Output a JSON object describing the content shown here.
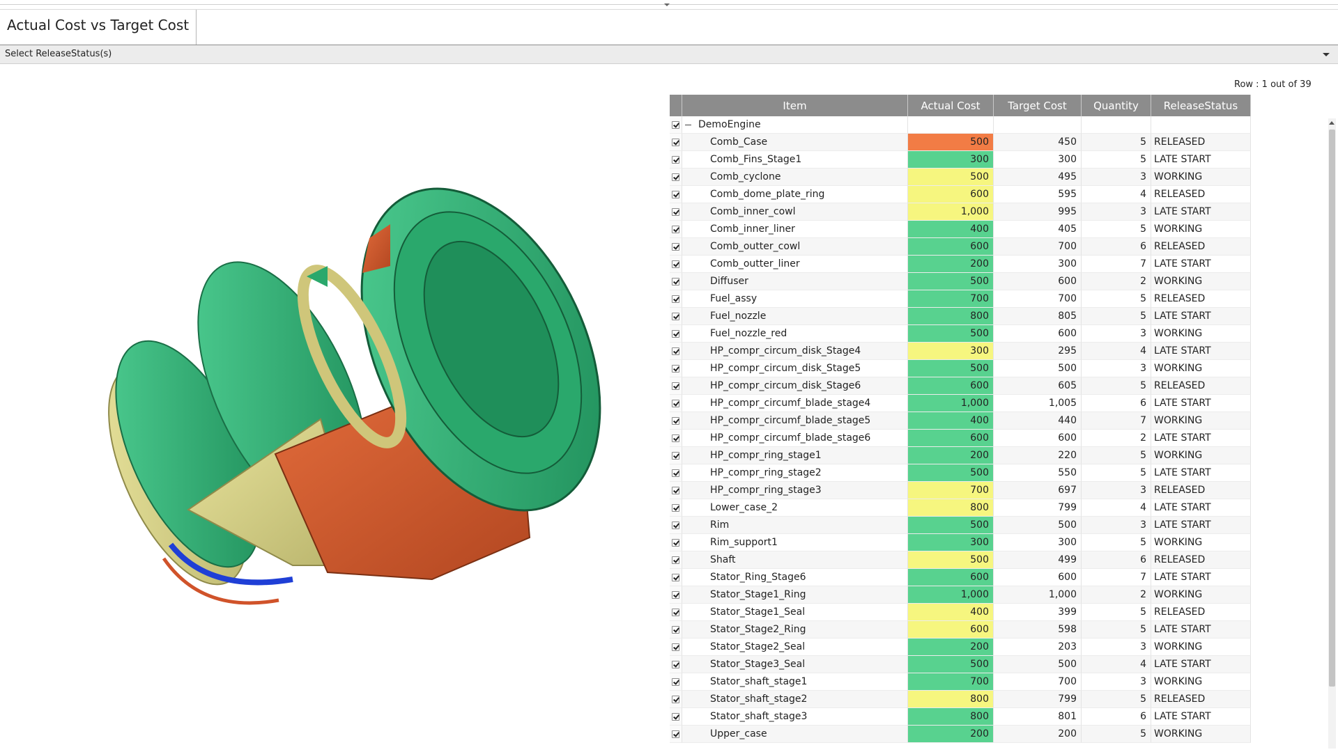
{
  "title": "Actual Cost vs Target Cost",
  "filter": {
    "label": "Select ReleaseStatus(s)"
  },
  "row_info": "Row : 1 out of 39",
  "viewer": {
    "model_name": "engine-3d-model"
  },
  "columns": [
    "Item",
    "Actual Cost",
    "Target Cost",
    "Quantity",
    "ReleaseStatus"
  ],
  "colors": {
    "over": "#f27c45",
    "under_or_equal": "#58d28f",
    "near": "#f6f67f"
  },
  "rows": [
    {
      "item": "DemoEngine",
      "actual": "",
      "target": "",
      "qty": "",
      "status": "",
      "level": "none",
      "parent": true
    },
    {
      "item": "Comb_Case",
      "actual": "500",
      "target": "450",
      "qty": "5",
      "status": "RELEASED",
      "level": "red"
    },
    {
      "item": "Comb_Fins_Stage1",
      "actual": "300",
      "target": "300",
      "qty": "5",
      "status": "LATE START",
      "level": "green"
    },
    {
      "item": "Comb_cyclone",
      "actual": "500",
      "target": "495",
      "qty": "3",
      "status": "WORKING",
      "level": "yellow"
    },
    {
      "item": "Comb_dome_plate_ring",
      "actual": "600",
      "target": "595",
      "qty": "4",
      "status": "RELEASED",
      "level": "yellow"
    },
    {
      "item": "Comb_inner_cowl",
      "actual": "1,000",
      "target": "995",
      "qty": "3",
      "status": "LATE START",
      "level": "yellow"
    },
    {
      "item": "Comb_inner_liner",
      "actual": "400",
      "target": "405",
      "qty": "5",
      "status": "WORKING",
      "level": "green"
    },
    {
      "item": "Comb_outter_cowl",
      "actual": "600",
      "target": "700",
      "qty": "6",
      "status": "RELEASED",
      "level": "green"
    },
    {
      "item": "Comb_outter_liner",
      "actual": "200",
      "target": "300",
      "qty": "7",
      "status": "LATE START",
      "level": "green"
    },
    {
      "item": "Diffuser",
      "actual": "500",
      "target": "600",
      "qty": "2",
      "status": "WORKING",
      "level": "green"
    },
    {
      "item": "Fuel_assy",
      "actual": "700",
      "target": "700",
      "qty": "5",
      "status": "RELEASED",
      "level": "green"
    },
    {
      "item": "Fuel_nozzle",
      "actual": "800",
      "target": "805",
      "qty": "5",
      "status": "LATE START",
      "level": "green"
    },
    {
      "item": "Fuel_nozzle_red",
      "actual": "500",
      "target": "600",
      "qty": "3",
      "status": "WORKING",
      "level": "green"
    },
    {
      "item": "HP_compr_circum_disk_Stage4",
      "actual": "300",
      "target": "295",
      "qty": "4",
      "status": "LATE START",
      "level": "yellow"
    },
    {
      "item": "HP_compr_circum_disk_Stage5",
      "actual": "500",
      "target": "500",
      "qty": "3",
      "status": "WORKING",
      "level": "green"
    },
    {
      "item": "HP_compr_circum_disk_Stage6",
      "actual": "600",
      "target": "605",
      "qty": "5",
      "status": "RELEASED",
      "level": "green"
    },
    {
      "item": "HP_compr_circumf_blade_stage4",
      "actual": "1,000",
      "target": "1,005",
      "qty": "6",
      "status": "LATE START",
      "level": "green"
    },
    {
      "item": "HP_compr_circumf_blade_stage5",
      "actual": "400",
      "target": "440",
      "qty": "7",
      "status": "WORKING",
      "level": "green"
    },
    {
      "item": "HP_compr_circumf_blade_stage6",
      "actual": "600",
      "target": "600",
      "qty": "2",
      "status": "LATE START",
      "level": "green"
    },
    {
      "item": "HP_compr_ring_stage1",
      "actual": "200",
      "target": "220",
      "qty": "5",
      "status": "WORKING",
      "level": "green"
    },
    {
      "item": "HP_compr_ring_stage2",
      "actual": "500",
      "target": "550",
      "qty": "5",
      "status": "LATE START",
      "level": "green"
    },
    {
      "item": "HP_compr_ring_stage3",
      "actual": "700",
      "target": "697",
      "qty": "3",
      "status": "RELEASED",
      "level": "yellow"
    },
    {
      "item": "Lower_case_2",
      "actual": "800",
      "target": "799",
      "qty": "4",
      "status": "LATE START",
      "level": "yellow"
    },
    {
      "item": "Rim",
      "actual": "500",
      "target": "500",
      "qty": "3",
      "status": "LATE START",
      "level": "green"
    },
    {
      "item": "Rim_support1",
      "actual": "300",
      "target": "300",
      "qty": "5",
      "status": "WORKING",
      "level": "green"
    },
    {
      "item": "Shaft",
      "actual": "500",
      "target": "499",
      "qty": "6",
      "status": "RELEASED",
      "level": "yellow"
    },
    {
      "item": "Stator_Ring_Stage6",
      "actual": "600",
      "target": "600",
      "qty": "7",
      "status": "LATE START",
      "level": "green"
    },
    {
      "item": "Stator_Stage1_Ring",
      "actual": "1,000",
      "target": "1,000",
      "qty": "2",
      "status": "WORKING",
      "level": "green"
    },
    {
      "item": "Stator_Stage1_Seal",
      "actual": "400",
      "target": "399",
      "qty": "5",
      "status": "RELEASED",
      "level": "yellow"
    },
    {
      "item": "Stator_Stage2_Ring",
      "actual": "600",
      "target": "598",
      "qty": "5",
      "status": "LATE START",
      "level": "yellow"
    },
    {
      "item": "Stator_Stage2_Seal",
      "actual": "200",
      "target": "203",
      "qty": "3",
      "status": "WORKING",
      "level": "green"
    },
    {
      "item": "Stator_Stage3_Seal",
      "actual": "500",
      "target": "500",
      "qty": "4",
      "status": "LATE START",
      "level": "green"
    },
    {
      "item": "Stator_shaft_stage1",
      "actual": "700",
      "target": "700",
      "qty": "3",
      "status": "WORKING",
      "level": "green"
    },
    {
      "item": "Stator_shaft_stage2",
      "actual": "800",
      "target": "799",
      "qty": "5",
      "status": "RELEASED",
      "level": "yellow"
    },
    {
      "item": "Stator_shaft_stage3",
      "actual": "800",
      "target": "801",
      "qty": "6",
      "status": "LATE START",
      "level": "green"
    },
    {
      "item": "Upper_case",
      "actual": "200",
      "target": "200",
      "qty": "5",
      "status": "WORKING",
      "level": "green"
    }
  ]
}
